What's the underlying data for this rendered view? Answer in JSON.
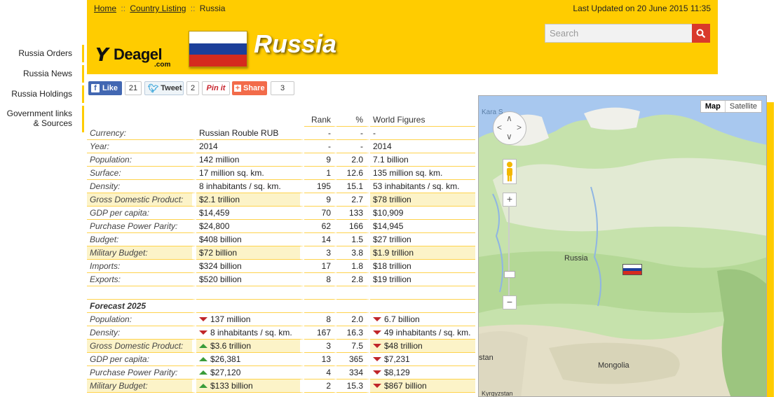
{
  "breadcrumb": {
    "home": "Home",
    "listing": "Country Listing",
    "sep": "::",
    "current": "Russia"
  },
  "last_updated": "Last Updated on 20 June 2015 11:35",
  "logo": {
    "name": "Deagel",
    "suffix": ".com"
  },
  "page_title": "Russia",
  "search": {
    "placeholder": "Search"
  },
  "colors": {
    "accent": "#ffcc00",
    "search_button": "#d9392b",
    "up": "#3a9c3a",
    "down": "#c0262a"
  },
  "sidebar": {
    "items": [
      {
        "label": "Russia Orders"
      },
      {
        "label": "Russia News"
      },
      {
        "label": "Russia Holdings"
      },
      {
        "label": "Government links & Sources"
      }
    ]
  },
  "social": {
    "like_label": "Like",
    "like_count": "21",
    "tweet_label": "Tweet",
    "tweet_count": "2",
    "pin_label": "Pin it",
    "share_label": "Share",
    "share_count": "3"
  },
  "table": {
    "headers": {
      "rank": "Rank",
      "pct": "%",
      "world": "World Figures"
    },
    "rows": [
      {
        "label": "Currency:",
        "value": "Russian Rouble RUB",
        "rank": "-",
        "pct": "-",
        "world": "-",
        "hl": false
      },
      {
        "label": "Year:",
        "value": "2014",
        "rank": "-",
        "pct": "-",
        "world": "2014",
        "hl": false
      },
      {
        "label": "Population:",
        "value": "142 million",
        "rank": "9",
        "pct": "2.0",
        "world": "7.1 billion",
        "hl": false
      },
      {
        "label": "Surface:",
        "value": "17 million sq. km.",
        "rank": "1",
        "pct": "12.6",
        "world": "135 million sq. km.",
        "hl": false
      },
      {
        "label": "Density:",
        "value": "8 inhabitants / sq. km.",
        "rank": "195",
        "pct": "15.1",
        "world": "53 inhabitants / sq. km.",
        "hl": false
      },
      {
        "label": "Gross Domestic Product:",
        "value": "$2.1 trillion",
        "rank": "9",
        "pct": "2.7",
        "world": "$78 trillion",
        "hl": true
      },
      {
        "label": "GDP per capita:",
        "value": "$14,459",
        "rank": "70",
        "pct": "133",
        "world": "$10,909",
        "hl": false
      },
      {
        "label": "Purchase Power Parity:",
        "value": "$24,800",
        "rank": "62",
        "pct": "166",
        "world": "$14,945",
        "hl": false
      },
      {
        "label": "Budget:",
        "value": "$408 billion",
        "rank": "14",
        "pct": "1.5",
        "world": "$27 trillion",
        "hl": false
      },
      {
        "label": "Military Budget:",
        "value": "$72 billion",
        "rank": "3",
        "pct": "3.8",
        "world": "$1.9 trillion",
        "hl": true
      },
      {
        "label": "Imports:",
        "value": "$324 billion",
        "rank": "17",
        "pct": "1.8",
        "world": "$18 trillion",
        "hl": false
      },
      {
        "label": "Exports:",
        "value": "$520 billion",
        "rank": "8",
        "pct": "2.8",
        "world": "$19 trillion",
        "hl": false
      }
    ],
    "forecast_title": "Forecast 2025",
    "forecast_rows": [
      {
        "label": "Population:",
        "value": "137 million",
        "vdir": "down",
        "rank": "8",
        "pct": "2.0",
        "world": "6.7 billion",
        "wdir": "down",
        "hl": false
      },
      {
        "label": "Density:",
        "value": "8 inhabitants / sq. km.",
        "vdir": "down",
        "rank": "167",
        "pct": "16.3",
        "world": "49 inhabitants / sq. km.",
        "wdir": "down",
        "hl": false
      },
      {
        "label": "Gross Domestic Product:",
        "value": "$3.6 trillion",
        "vdir": "up",
        "rank": "3",
        "pct": "7.5",
        "world": "$48 trillion",
        "wdir": "down",
        "hl": true
      },
      {
        "label": "GDP per capita:",
        "value": "$26,381",
        "vdir": "up",
        "rank": "13",
        "pct": "365",
        "world": "$7,231",
        "wdir": "down",
        "hl": false
      },
      {
        "label": "Purchase Power Parity:",
        "value": "$27,120",
        "vdir": "up",
        "rank": "4",
        "pct": "334",
        "world": "$8,129",
        "wdir": "down",
        "hl": false
      },
      {
        "label": "Military Budget:",
        "value": "$133 billion",
        "vdir": "up",
        "rank": "2",
        "pct": "15.3",
        "world": "$867 billion",
        "wdir": "down",
        "hl": true
      }
    ]
  },
  "map": {
    "map_tab": "Map",
    "satellite_tab": "Satellite",
    "labels": {
      "kara": "Kara S",
      "russia": "Russia",
      "mongolia": "Mongolia",
      "stan": "stan",
      "kyrgyzstan": "Kyrgyzstan"
    }
  }
}
